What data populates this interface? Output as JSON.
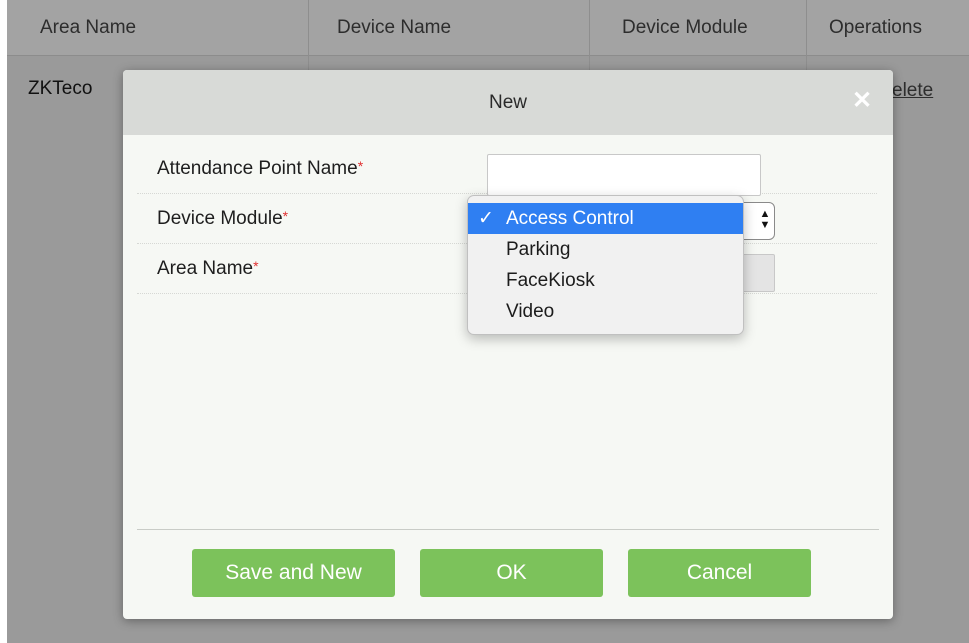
{
  "background": {
    "table": {
      "columns": [
        "Area Name",
        "Device Name",
        "Device Module",
        "Operations"
      ],
      "rows": [
        {
          "area_name": "ZKTeco",
          "operation": "elete"
        }
      ]
    }
  },
  "modal": {
    "title": "New",
    "close_glyph": "✕",
    "fields": [
      {
        "label": "Attendance Point Name",
        "required_mark": "*",
        "value": ""
      },
      {
        "label": "Device Module",
        "required_mark": "*",
        "value": "Access Control"
      },
      {
        "label": "Area Name",
        "required_mark": "*",
        "value": ""
      }
    ],
    "buttons": {
      "save_and_new": "Save and New",
      "ok": "OK",
      "cancel": "Cancel"
    }
  },
  "dropdown": {
    "check_glyph": "✓",
    "options": [
      "Access Control",
      "Parking",
      "FaceKiosk",
      "Video"
    ],
    "selected": "Access Control"
  },
  "colors": {
    "accent_green": "#7cc25b",
    "selection_blue": "#2f7ff2",
    "required_red": "#e03030"
  }
}
